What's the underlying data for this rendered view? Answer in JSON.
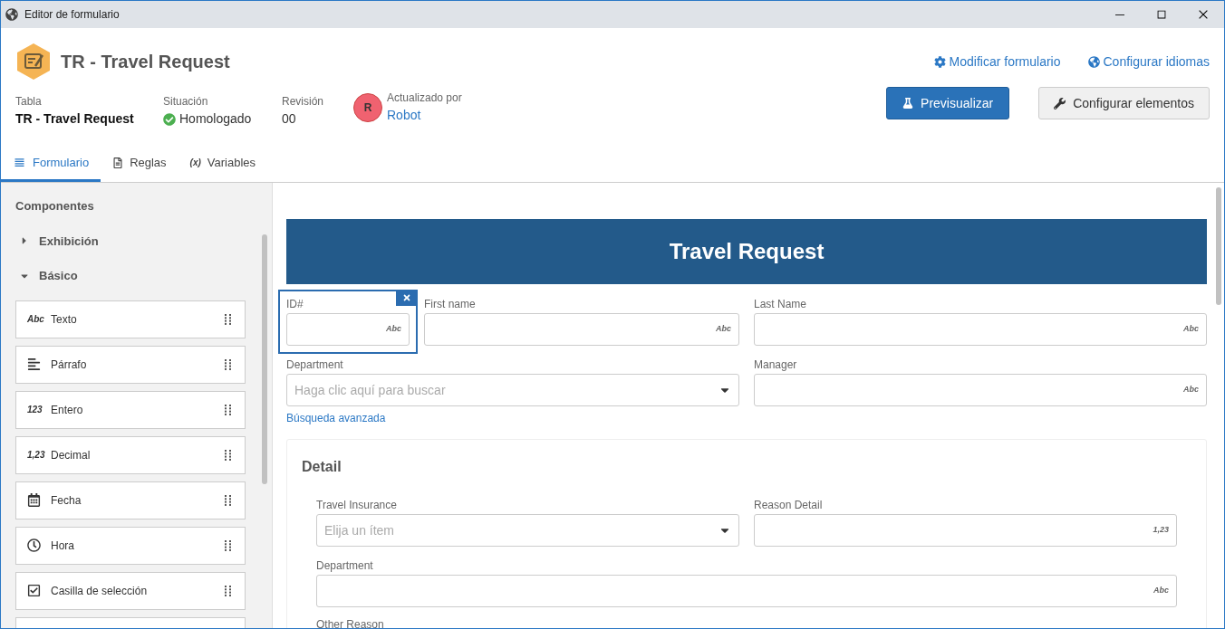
{
  "window": {
    "title": "Editor de formulario"
  },
  "header": {
    "title": "TR - Travel Request",
    "links": [
      {
        "kind": "gear",
        "label": "Modificar formulario"
      },
      {
        "kind": "globe",
        "label": "Configurar idiomas"
      }
    ],
    "info": [
      {
        "kind": "plain",
        "label": "Tabla",
        "value": "TR - Travel Request"
      },
      {
        "kind": "status",
        "label": "Situación",
        "value": "Homologado"
      },
      {
        "kind": "number",
        "label": "Revisión",
        "value": "00"
      }
    ],
    "updated": {
      "initial": "R",
      "label": "Actualizado por",
      "value": "Robot"
    },
    "buttons": [
      {
        "kind": "primary",
        "label": "Previsualizar"
      },
      {
        "kind": "secondary",
        "label": "Configurar elementos"
      }
    ]
  },
  "tabs": [
    {
      "kind": "form",
      "label": "Formulario",
      "selected": true
    },
    {
      "kind": "rules",
      "label": "Reglas",
      "selected": false
    },
    {
      "kind": "variables",
      "label": "Variables",
      "selected": false,
      "tag": "(x)"
    }
  ],
  "sidebar": {
    "title": "Componentes",
    "groups": [
      {
        "label": "Exhibición",
        "expanded": false
      },
      {
        "label": "Básico",
        "expanded": true
      }
    ],
    "items": [
      {
        "kind": "tag",
        "tag": "Abc",
        "label": "Texto"
      },
      {
        "kind": "paragraph",
        "label": "Párrafo"
      },
      {
        "kind": "tag",
        "tag": "123",
        "label": "Entero"
      },
      {
        "kind": "tag",
        "tag": "1,23",
        "label": "Decimal"
      },
      {
        "kind": "calendar",
        "label": "Fecha"
      },
      {
        "kind": "clock",
        "label": "Hora"
      },
      {
        "kind": "checkbox",
        "label": "Casilla de selección"
      }
    ]
  },
  "form": {
    "banner": "Travel Request",
    "rows": [
      {
        "left": [
          {
            "kind": "text",
            "label": "ID#",
            "tag": "Abc",
            "selected": true
          },
          {
            "kind": "text",
            "label": "First name",
            "tag": "Abc",
            "selected": false
          }
        ],
        "right": [
          {
            "kind": "text",
            "label": "Last Name",
            "tag": "Abc",
            "selected": false
          }
        ]
      },
      {
        "left": [
          {
            "kind": "select",
            "label": "Department",
            "placeholder": "Haga clic aquí para buscar",
            "link": "Búsqueda avanzada",
            "selected": false
          }
        ],
        "right": [
          {
            "kind": "text",
            "label": "Manager",
            "tag": "Abc",
            "selected": false
          }
        ]
      }
    ],
    "section": {
      "title": "Detail",
      "rows": [
        [
          {
            "kind": "select",
            "label": "Travel Insurance",
            "placeholder": "Elija un ítem",
            "selected": false
          },
          {
            "kind": "text",
            "label": "Reason Detail",
            "tag": "1,23",
            "selected": false
          }
        ],
        [
          {
            "kind": "text",
            "label": "Department",
            "tag": "Abc",
            "selected": false
          }
        ]
      ],
      "trailing_label": "Other Reason"
    }
  }
}
